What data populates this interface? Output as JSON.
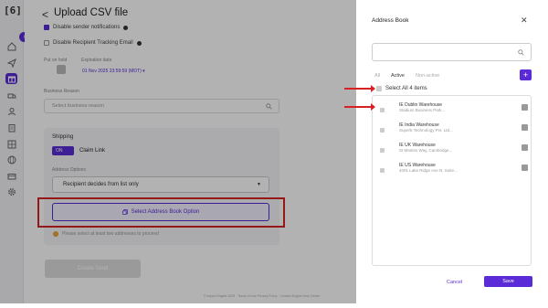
{
  "sidebar": {
    "logo": "[6]",
    "collapse_glyph": "›",
    "icons": [
      "home-icon",
      "send-icon",
      "gift-icon",
      "truck-icon",
      "user-icon",
      "clipboard-icon",
      "gifts-grid-icon",
      "globe-icon",
      "wallet-icon",
      "settings-icon"
    ]
  },
  "main": {
    "back_glyph": "<",
    "title": "Upload CSV file",
    "disable_sender_notifications": "Disable sender notifications",
    "disable_recipient_tracking": "Disable Recipient Tracking Email",
    "put_on_hold_label": "Put on hold",
    "expiration_date_label": "Expiration date",
    "expiration_date_value": "01 Nov 2025 23:59:59 (MDT) ▾",
    "business_reason_label": "Business Reason",
    "business_reason_placeholder": "Select business reason",
    "shipping_label": "Shipping",
    "toggle_text": "ON",
    "claim_link_label": "Claim Link",
    "address_options_label": "Address Options",
    "address_options_value": "Recipient decides from list only",
    "select_address_button": "Select Address Book Option",
    "warning_text": "Please select at least two addresses to proceed",
    "create_button": "Create Send",
    "footer": "© Import Engine 2025 · Terms of Use Privacy Policy · Contact Engine Help Center"
  },
  "panel": {
    "title": "Address Book",
    "close_glyph": "✕",
    "search_placeholder": "",
    "tabs": [
      "All",
      "Active",
      "Non-active"
    ],
    "active_tab": "Active",
    "add_glyph": "+",
    "select_all_label": "Select All 4 items",
    "addresses": [
      {
        "name": "IE Dublin Warehouse",
        "line": "Stadium Business Park..."
      },
      {
        "name": "IE India Warehouse",
        "line": "Superb Technology Pvt. Ltd..."
      },
      {
        "name": "IE UK Warehouse",
        "line": "St Martins Way, Cambridge..."
      },
      {
        "name": "IE US Warehouse",
        "line": "4001 Lake Ridge Ave N. Suite..."
      }
    ],
    "cancel_label": "Cancel",
    "save_label": "Save"
  },
  "colors": {
    "accent": "#5a2bd6",
    "annotation_red": "#d62222"
  }
}
